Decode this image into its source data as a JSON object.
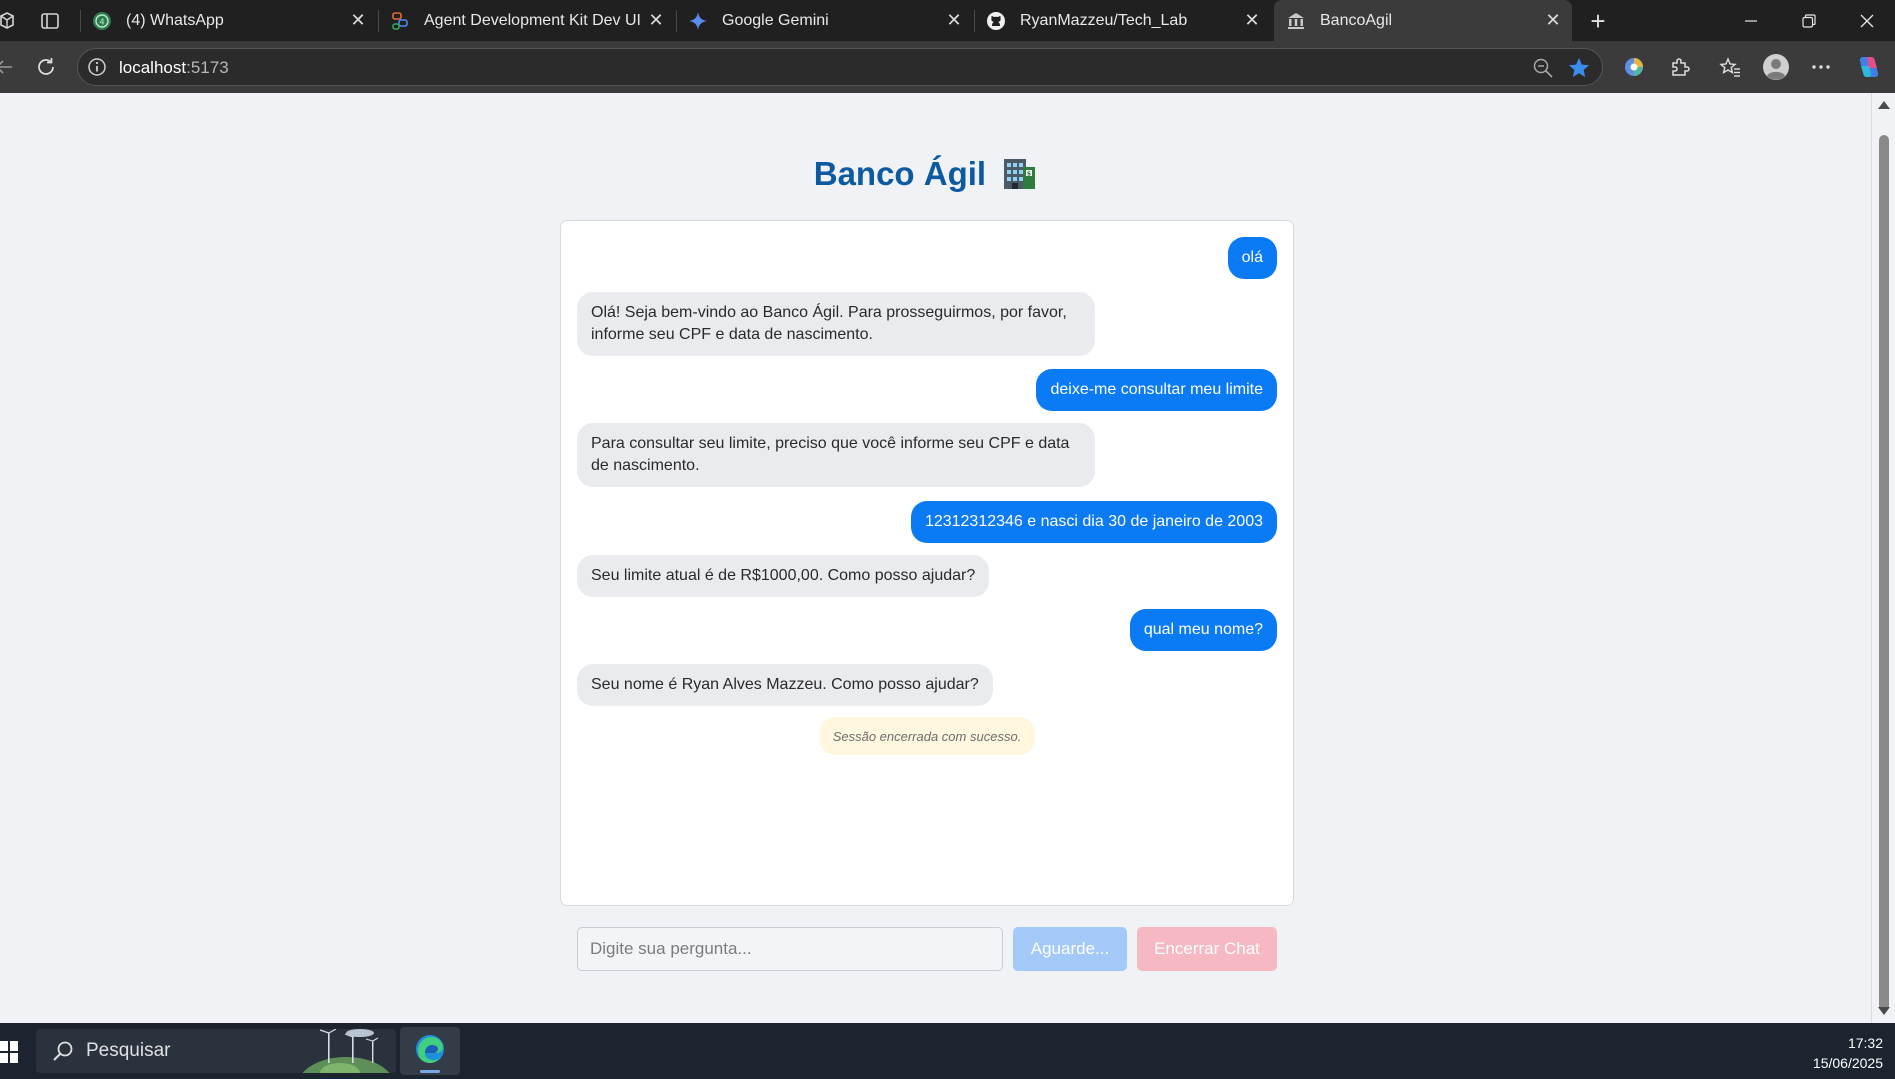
{
  "browser": {
    "tabs": [
      {
        "title": "(4) WhatsApp",
        "icon": "whatsapp-icon",
        "active": false
      },
      {
        "title": "Agent Development Kit Dev UI",
        "icon": "adk-icon",
        "active": false
      },
      {
        "title": "Google Gemini",
        "icon": "gemini-icon",
        "active": false
      },
      {
        "title": "RyanMazzeu/Tech_Lab",
        "icon": "github-icon",
        "active": false
      },
      {
        "title": "BancoAgil",
        "icon": "bank-icon",
        "active": true
      }
    ],
    "address": {
      "host": "localhost",
      "port": ":5173"
    }
  },
  "page": {
    "title": "Banco Ágil",
    "title_icon": "bank-building-emoji",
    "messages": [
      {
        "role": "user",
        "text": "olá"
      },
      {
        "role": "bot",
        "text": "Olá! Seja bem-vindo ao Banco Ágil. Para prosseguirmos, por favor, informe seu CPF e data de nascimento."
      },
      {
        "role": "user",
        "text": "deixe-me consultar meu limite"
      },
      {
        "role": "bot",
        "text": "Para consultar seu limite, preciso que você informe seu CPF e data de nascimento."
      },
      {
        "role": "user",
        "text": "12312312346 e nasci dia 30 de janeiro de 2003"
      },
      {
        "role": "bot",
        "text": "Seu limite atual é de R$1000,00. Como posso ajudar?"
      },
      {
        "role": "user",
        "text": "qual meu nome?"
      },
      {
        "role": "bot",
        "text": "Seu nome é Ryan Alves Mazzeu. Como posso ajudar?"
      }
    ],
    "system_note": "Sessão encerrada com sucesso.",
    "input": {
      "placeholder": "Digite sua pergunta...",
      "value": ""
    },
    "send_label": "Aguarde...",
    "end_label": "Encerrar Chat",
    "colors": {
      "title": "#0d5aa0",
      "user_bubble": "#0b7af5",
      "bot_bubble": "#e9ebee",
      "send_disabled": "#a3c9f8",
      "end_disabled": "#f6b9c2",
      "note_bg": "#fff8df"
    }
  },
  "taskbar": {
    "search_label": "Pesquisar",
    "time": "17:32",
    "date": "15/06/2025"
  }
}
